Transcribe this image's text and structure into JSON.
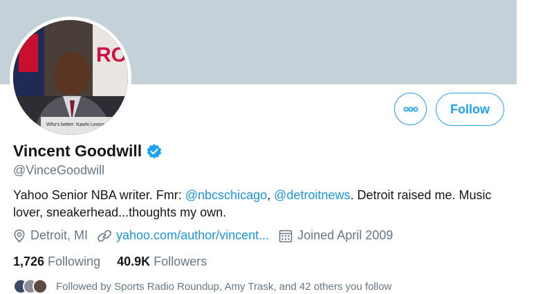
{
  "profile": {
    "name": "Vincent Goodwill",
    "handle": "@VinceGoodwill",
    "bio": {
      "prefix": "Yahoo Senior NBA writer. Fmr: ",
      "mention1": "@nbcschicago",
      "sep": ", ",
      "mention2": "@detroitnews",
      "suffix": ". Detroit raised me. Music lover, sneakerhead...thoughts my own."
    },
    "location": "Detroit, MI",
    "website": "yahoo.com/author/vincent...",
    "joined": "Joined April 2009",
    "following_count": "1,726",
    "following_label": "Following",
    "followers_count": "40.9K",
    "followers_label": "Followers",
    "followed_by": "Followed by Sports Radio Roundup, Amy Trask, and 42 others you follow",
    "avatar_caption": "Who's better: Kawhi Leonard o"
  },
  "buttons": {
    "follow": "Follow",
    "more_icon": "more-dots-icon"
  },
  "colors": {
    "accent": "#1da1f2",
    "link": "#1b95e0",
    "banner": "#c5d1d8",
    "secondary_text": "#657786"
  }
}
